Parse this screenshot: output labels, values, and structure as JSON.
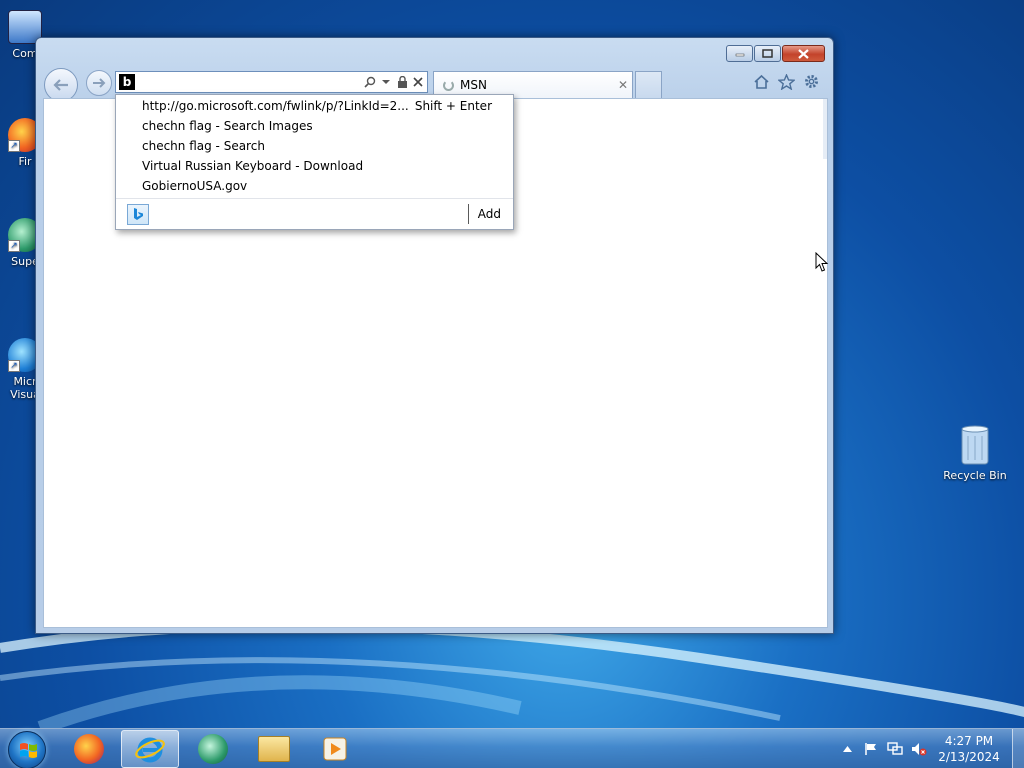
{
  "desktop": {
    "icons": [
      {
        "label": "Com",
        "icon": "computer-icon"
      },
      {
        "label": "Fir",
        "icon": "firefox-icon"
      },
      {
        "label": "Supe",
        "icon": "app-icon"
      },
      {
        "label": "Micr\nVisua",
        "icon": "edge-icon"
      }
    ],
    "recycle_bin": {
      "label": "Recycle Bin",
      "icon": "recycle-bin-icon"
    }
  },
  "browser": {
    "address": {
      "value": "",
      "placeholder": ""
    },
    "tab": {
      "title": "MSN"
    },
    "suggestions": [
      {
        "text": "http://go.microsoft.com/fwlink/p/?LinkId=2...",
        "hint": "Shift + Enter"
      },
      {
        "text": "chechn flag - Search Images",
        "hint": ""
      },
      {
        "text": "chechn flag - Search",
        "hint": ""
      },
      {
        "text": "Virtual Russian Keyboard - Download",
        "hint": ""
      },
      {
        "text": "GobiernoUSA.gov",
        "hint": ""
      }
    ],
    "footer": {
      "add_label": "Add"
    }
  },
  "taskbar": {
    "apps": [
      "firefox-icon",
      "internet-explorer-icon",
      "app-icon",
      "file-explorer-icon",
      "media-player-icon"
    ],
    "clock": {
      "time": "4:27 PM",
      "date": "2/13/2024"
    }
  },
  "colors": {
    "accent": "#1a6fc4",
    "close_button": "#c3432b"
  }
}
